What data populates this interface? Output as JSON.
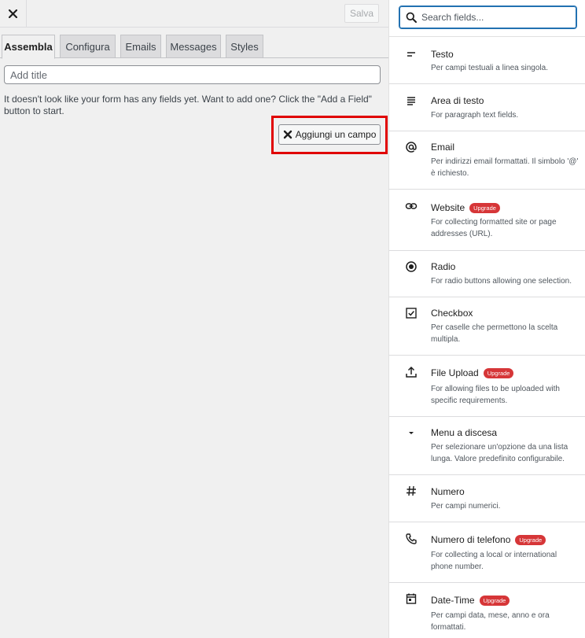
{
  "header": {
    "save_label": "Salva"
  },
  "tabs": [
    {
      "label": "Assembla"
    },
    {
      "label": "Configura"
    },
    {
      "label": "Emails"
    },
    {
      "label": "Messages"
    },
    {
      "label": "Styles"
    }
  ],
  "form": {
    "title_placeholder": "Add title",
    "title_value": "",
    "notice": "It doesn't look like your form has any fields yet. Want to add one? Click the \"Add a Field\" button to start.",
    "add_field_label": "Aggiungi un campo"
  },
  "sidebar": {
    "search_placeholder": "Search fields...",
    "fields": [
      {
        "name": "Testo",
        "desc": "Per campi testuali a linea singola.",
        "icon": "short-text-icon"
      },
      {
        "name": "Area di testo",
        "desc": "For paragraph text fields.",
        "icon": "paragraph-icon"
      },
      {
        "name": "Email",
        "desc": "Per indirizzi email formattati. Il simbolo '@' è richiesto.",
        "icon": "at-sign-icon"
      },
      {
        "name": "Website",
        "desc": "For collecting formatted site or page addresses (URL).",
        "icon": "link-icon",
        "badge": "Upgrade"
      },
      {
        "name": "Radio",
        "desc": "For radio buttons allowing one selection.",
        "icon": "radio-icon"
      },
      {
        "name": "Checkbox",
        "desc": "Per caselle che permettono la scelta multipla.",
        "icon": "checkbox-icon"
      },
      {
        "name": "File Upload",
        "desc": "For allowing files to be uploaded with specific requirements.",
        "icon": "upload-icon",
        "badge": "Upgrade"
      },
      {
        "name": "Menu a discesa",
        "desc": "Per selezionare un'opzione da una lista lunga. Valore predefinito configurabile.",
        "icon": "caret-down-icon"
      },
      {
        "name": "Numero",
        "desc": "Per campi numerici.",
        "icon": "hash-icon"
      },
      {
        "name": "Numero di telefono",
        "desc": "For collecting a local or international phone number.",
        "icon": "phone-icon",
        "badge": "Upgrade"
      },
      {
        "name": "Date-Time",
        "desc": "Per campi data, mese, anno e ora formattati.",
        "icon": "calendar-icon",
        "badge": "Upgrade"
      }
    ]
  },
  "colors": {
    "highlight": "#e00000",
    "badge": "#d63638",
    "focus": "#2271b1"
  }
}
